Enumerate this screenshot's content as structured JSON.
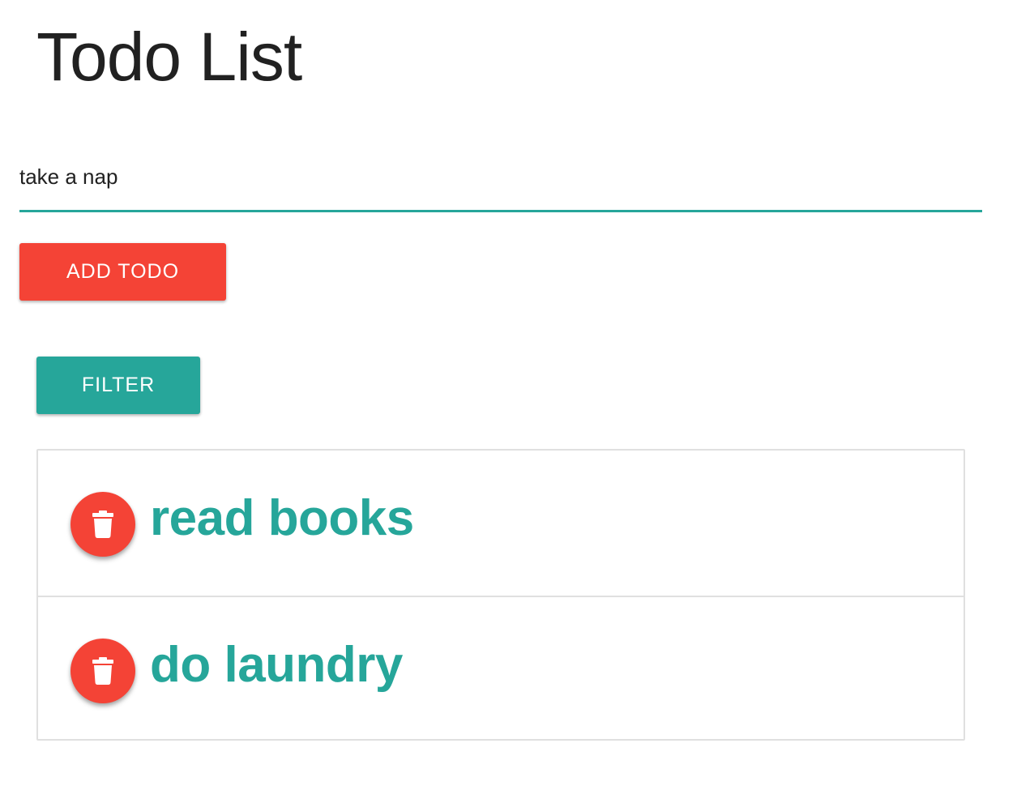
{
  "page": {
    "title": "Todo List"
  },
  "todo_input": {
    "value": "take a nap",
    "placeholder": ""
  },
  "buttons": {
    "add_label": "ADD TODO",
    "filter_label": "FILTER"
  },
  "todos": [
    {
      "text": "read books",
      "delete_icon": "trash-icon"
    },
    {
      "text": "do laundry",
      "delete_icon": "trash-icon"
    }
  ],
  "colors": {
    "accent_teal": "#26a69a",
    "accent_red": "#f44336",
    "text_dark": "#212121",
    "border_gray": "#e0e0e0"
  }
}
